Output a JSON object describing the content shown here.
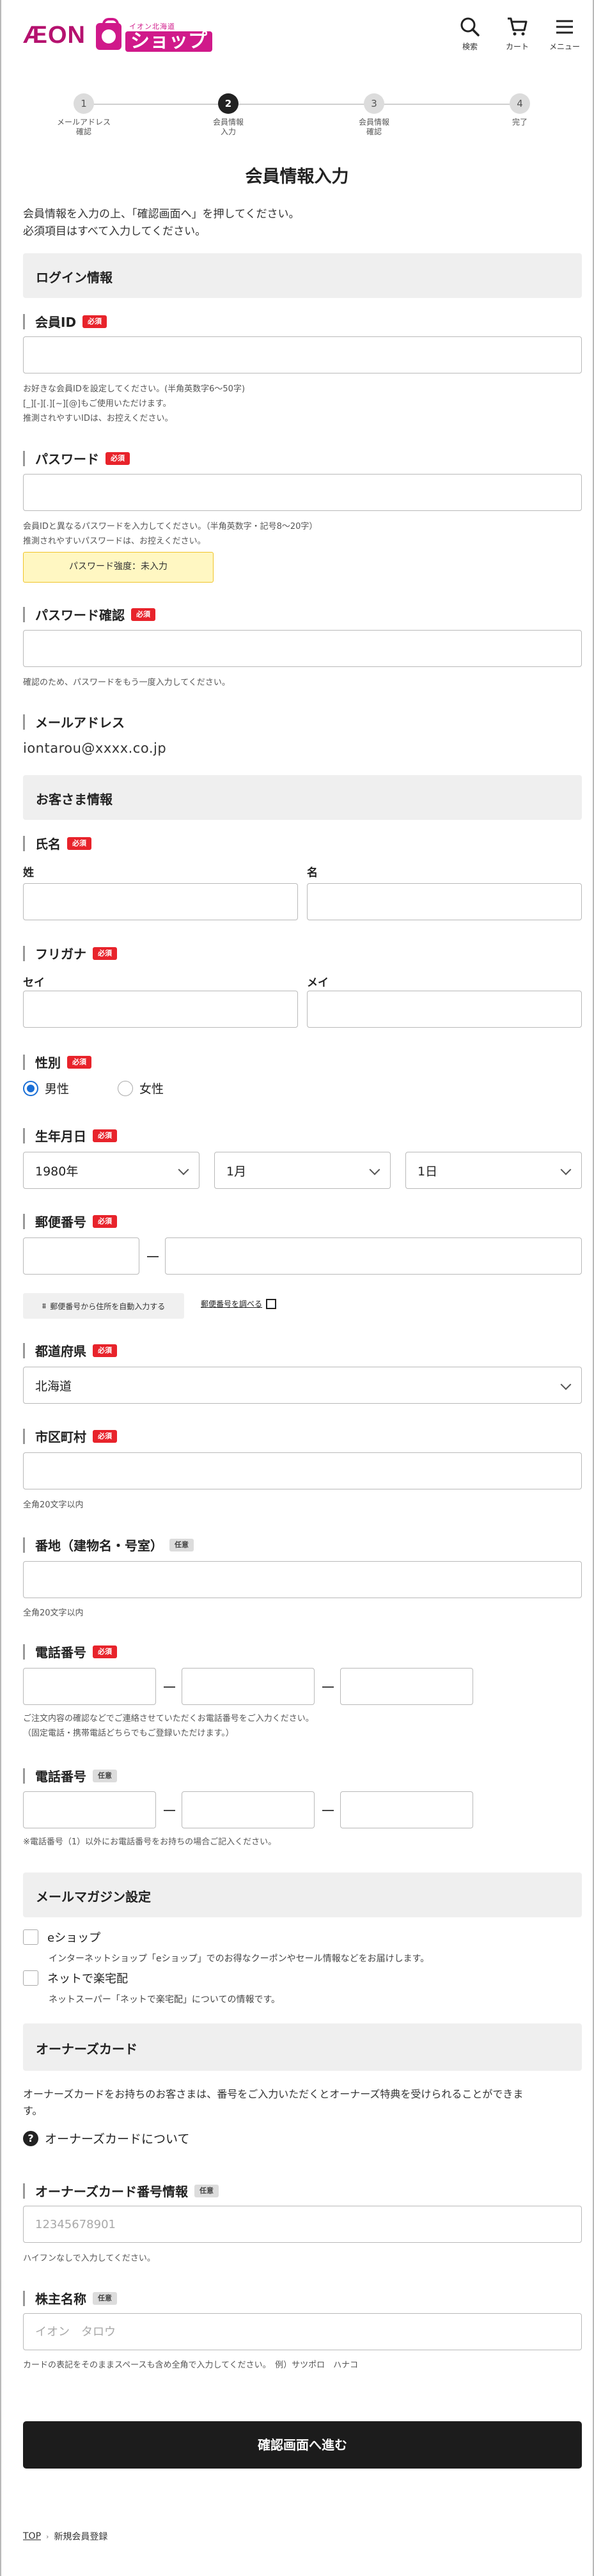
{
  "header": {
    "logo_aeon": "ÆON",
    "logo_shop_sub": "イオン北海道",
    "logo_shop_main": "ショップ",
    "icons": [
      {
        "label": "検索",
        "icon": "search-icon"
      },
      {
        "label": "カート",
        "icon": "cart-icon"
      },
      {
        "label": "メニュー",
        "icon": "menu-icon"
      }
    ]
  },
  "stepper": {
    "steps": [
      {
        "num": "1",
        "label": "メールアドレス\n確認",
        "active": false
      },
      {
        "num": "2",
        "label": "会員情報\n入力",
        "active": true
      },
      {
        "num": "3",
        "label": "会員情報\n確認",
        "active": false
      },
      {
        "num": "4",
        "label": "完了",
        "active": false
      }
    ]
  },
  "page_title": "会員情報入力",
  "intro": {
    "line1": "会員情報を入力の上、「確認画面へ」を押してください。",
    "line2": "必須項目はすべて入力してください。"
  },
  "badges": {
    "required": "必須",
    "optional": "任意"
  },
  "login_section": {
    "title": "ログイン情報",
    "member_id": {
      "label": "会員ID",
      "value": "",
      "help1": "お好きな会員IDを設定してください。(半角英数字6〜50字)",
      "help2": "[_][-][.][~][@]もご使用いただけます。",
      "help3": "推測されやすいIDは、お控えください。"
    },
    "password": {
      "label": "パスワード",
      "value": "",
      "help1": "会員IDと異なるパスワードを入力してください。（半角英数字・記号8〜20字）",
      "help2": "推測されやすいパスワードは、お控えください。",
      "strength": "パスワード強度：未入力"
    },
    "password_confirm": {
      "label": "パスワード確認",
      "value": "",
      "help": "確認のため、パスワードをもう一度入力してください。"
    },
    "email": {
      "label": "メールアドレス",
      "value": "iontarou@xxxx.co.jp"
    }
  },
  "customer_section": {
    "title": "お客さま情報",
    "name": {
      "label": "氏名",
      "sei": "姓",
      "mei": "名"
    },
    "furigana": {
      "label": "フリガナ",
      "sei": "セイ",
      "mei": "メイ"
    },
    "gender": {
      "label": "性別",
      "options": [
        "男性",
        "女性"
      ],
      "selected": "男性"
    },
    "birthday": {
      "label": "生年月日",
      "year": "1980年",
      "month": "1月",
      "day": "1日"
    },
    "postal": {
      "label": "郵便番号",
      "autofill_button": "郵便番号から住所を自動入力する",
      "lookup_link": "郵便番号を調べる"
    },
    "prefecture": {
      "label": "都道府県",
      "value": "北海道"
    },
    "city": {
      "label": "市区町村",
      "help": "全角20文字以内"
    },
    "address": {
      "label": "番地（建物名・号室）",
      "help": "全角20文字以内"
    },
    "phone1": {
      "label": "電話番号",
      "help1": "ご注文内容の確認などでご連絡させていただくお電話番号をご入力ください。",
      "help2": "（固定電話・携帯電話どちらでもご登録いただけます。）"
    },
    "phone2": {
      "label": "電話番号",
      "help": "※電話番号（1）以外にお電話番号をお持ちの場合ご記入ください。"
    }
  },
  "magazine_section": {
    "title": "メールマガジン設定",
    "items": [
      {
        "label": "eショップ",
        "desc": "インターネットショップ「eショップ」でのお得なクーポンやセール情報などをお届けします。"
      },
      {
        "label": "ネットで楽宅配",
        "desc": "ネットスーパー「ネットで楽宅配」についての情報です。"
      }
    ]
  },
  "owner_section": {
    "title": "オーナーズカード",
    "desc1": "オーナーズカードをお持ちのお客さまは、番号をご入力いただくとオーナーズ特典を受けられることができま",
    "desc2": "す。",
    "info_link": "オーナーズカードについて",
    "card_number": {
      "label": "オーナーズカード番号情報",
      "placeholder": "12345678901",
      "help": "ハイフンなしで入力してください。"
    },
    "holder_name": {
      "label": "株主名称",
      "placeholder": "イオン　タロウ",
      "help": "カードの表記をそのままスペースも含め全角で入力してください。　例）サツポロ　ハナコ"
    }
  },
  "submit_label": "確認画面へ進む",
  "breadcrumb": {
    "top": "TOP",
    "current": "新規会員登録"
  },
  "colors": {
    "brand": "#b5126f",
    "required_badge": "#e8232b",
    "radio_selected": "#1a6fd6",
    "strength_bg": "#fff7c2",
    "strength_border": "#f0c428"
  }
}
